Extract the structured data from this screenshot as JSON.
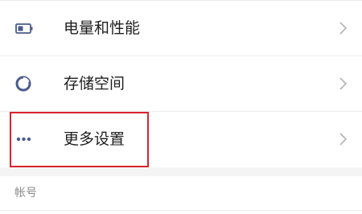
{
  "settings": {
    "items": [
      {
        "label": "电量和性能",
        "icon": "battery-icon"
      },
      {
        "label": "存储空间",
        "icon": "storage-pie-icon"
      },
      {
        "label": "更多设置",
        "icon": "more-dots-icon"
      }
    ],
    "section_header": "帐号"
  },
  "colors": {
    "icon_color": "#4a5b8c",
    "chevron_color": "#b3b3b3",
    "highlight_border": "#d9232e",
    "section_bg": "#f4f4f4"
  }
}
